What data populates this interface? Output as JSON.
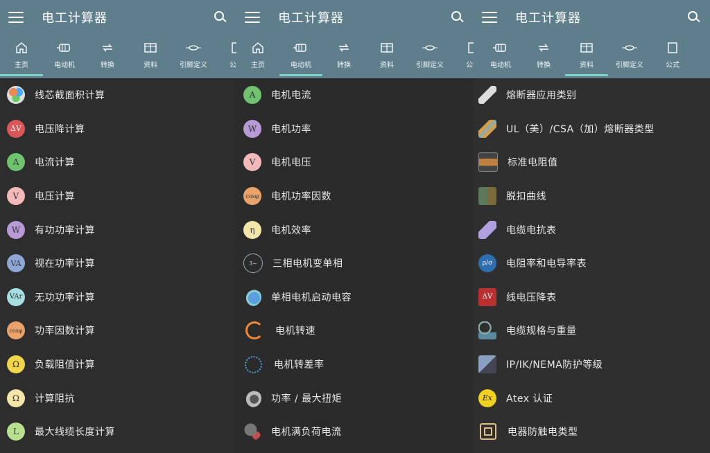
{
  "app": {
    "title": "电工计算器"
  },
  "colors": {
    "appbar": "#5f7e8c",
    "indicator": "#7fd3c4",
    "background": "#2d2d2d"
  },
  "panels": [
    {
      "tabs": [
        {
          "label": "主页",
          "icon": "home-icon",
          "active": true
        },
        {
          "label": "电动机",
          "icon": "motor-icon"
        },
        {
          "label": "转换",
          "icon": "convert-icon"
        },
        {
          "label": "资料",
          "icon": "book-icon"
        },
        {
          "label": "引脚定义",
          "icon": "pin-icon"
        },
        {
          "label": "公式",
          "icon": "formula-icon"
        }
      ],
      "items": [
        {
          "label": "线芯截面积计算",
          "icon": "wire-core-icon",
          "glyph": "",
          "color": "#cfcfcf"
        },
        {
          "label": "电压降计算",
          "icon": "voltage-drop-icon",
          "glyph": "ΔV",
          "color": "#e66"
        },
        {
          "label": "电流计算",
          "icon": "ampere-icon",
          "glyph": "A",
          "color": "#7ccf7c"
        },
        {
          "label": "电压计算",
          "icon": "volt-icon",
          "glyph": "V",
          "color": "#f4b6b6"
        },
        {
          "label": "有功功率计算",
          "icon": "watt-icon",
          "glyph": "W",
          "color": "#b79ad6"
        },
        {
          "label": "视在功率计算",
          "icon": "va-icon",
          "glyph": "VA",
          "color": "#8fa6d8"
        },
        {
          "label": "无功功率计算",
          "icon": "var-icon",
          "glyph": "VAr",
          "color": "#a6dde0"
        },
        {
          "label": "功率因数计算",
          "icon": "cosphi-icon",
          "glyph": "cosφ",
          "color": "#e9a36a"
        },
        {
          "label": "负载阻值计算",
          "icon": "ohm-icon",
          "glyph": "Ω",
          "color": "#f2d64a"
        },
        {
          "label": "计算阻抗",
          "icon": "impedance-icon",
          "glyph": "Ω",
          "color": "#f4e6a8"
        },
        {
          "label": "最大线缆长度计算",
          "icon": "cable-length-icon",
          "glyph": "L",
          "color": "#b8e08f"
        }
      ]
    },
    {
      "tabs": [
        {
          "label": "主页",
          "icon": "home-icon"
        },
        {
          "label": "电动机",
          "icon": "motor-icon",
          "active": true
        },
        {
          "label": "转换",
          "icon": "convert-icon"
        },
        {
          "label": "资料",
          "icon": "book-icon"
        },
        {
          "label": "引脚定义",
          "icon": "pin-icon"
        },
        {
          "label": "公式",
          "icon": "formula-icon"
        }
      ],
      "items": [
        {
          "label": "电机电流",
          "icon": "ampere-icon",
          "glyph": "A",
          "color": "#7ccf7c"
        },
        {
          "label": "电机功率",
          "icon": "watt-icon",
          "glyph": "W",
          "color": "#b79ad6"
        },
        {
          "label": "电机电压",
          "icon": "volt-icon",
          "glyph": "V",
          "color": "#f4b6b6"
        },
        {
          "label": "电机功率因数",
          "icon": "cosphi-icon",
          "glyph": "cosφ",
          "color": "#e9a36a"
        },
        {
          "label": "电机效率",
          "icon": "eta-icon",
          "glyph": "η",
          "color": "#f4e6a8"
        },
        {
          "label": "三相电机变单相",
          "icon": "three-to-single-icon",
          "glyph": "3~",
          "color": "#4a5b6a"
        },
        {
          "label": "单相电机启动电容",
          "icon": "capacitor-icon",
          "glyph": "",
          "color": "#5aa0e0"
        },
        {
          "label": "电机转速",
          "icon": "speed-icon",
          "glyph": "",
          "color": "#f08a3a"
        },
        {
          "label": "电机转差率",
          "icon": "slip-icon",
          "glyph": "",
          "color": "#4aa6e0"
        },
        {
          "label": "功率 / 最大扭矩",
          "icon": "torque-icon",
          "glyph": "",
          "color": "#9a9a9a"
        },
        {
          "label": "电机满负荷电流",
          "icon": "full-load-icon",
          "glyph": "",
          "color": "#c05050"
        }
      ]
    },
    {
      "tabs": [
        {
          "label": "电动机",
          "icon": "motor-icon"
        },
        {
          "label": "转换",
          "icon": "convert-icon"
        },
        {
          "label": "资料",
          "icon": "book-icon",
          "active": true
        },
        {
          "label": "引脚定义",
          "icon": "pin-icon"
        },
        {
          "label": "公式",
          "icon": "formula-icon"
        }
      ],
      "items": [
        {
          "label": "熔断器应用类别",
          "icon": "fuse-icon",
          "glyph": "",
          "color": "#cfcfcf"
        },
        {
          "label": "UL（美）/CSA（加）熔断器类型",
          "icon": "fuse-type-icon",
          "glyph": "",
          "color": "#d0a050"
        },
        {
          "label": "标准电阻值",
          "icon": "resistor-icon",
          "glyph": "",
          "color": "#c08040"
        },
        {
          "label": "脱扣曲线",
          "icon": "trip-curve-icon",
          "glyph": "",
          "color": "#5a7a5a"
        },
        {
          "label": "电缆电抗表",
          "icon": "cable-reactance-icon",
          "glyph": "",
          "color": "#b0a0e0"
        },
        {
          "label": "电阻率和电导率表",
          "icon": "resistivity-icon",
          "glyph": "ρ/σ",
          "color": "#3a7ac0"
        },
        {
          "label": "线电压降表",
          "icon": "line-drop-icon",
          "glyph": "ΔV",
          "color": "#c03a3a"
        },
        {
          "label": "电缆规格与重量",
          "icon": "cable-weight-icon",
          "glyph": "",
          "color": "#6a8aa0"
        },
        {
          "label": "IP/IK/NEMA防护等级",
          "icon": "protection-icon",
          "glyph": "",
          "color": "#8aa0c0"
        },
        {
          "label": "Atex 认证",
          "icon": "atex-icon",
          "glyph": "Ex",
          "color": "#f2d020"
        },
        {
          "label": "电器防触电类型",
          "icon": "shock-class-icon",
          "glyph": "",
          "color": "#e0c080"
        }
      ]
    }
  ]
}
